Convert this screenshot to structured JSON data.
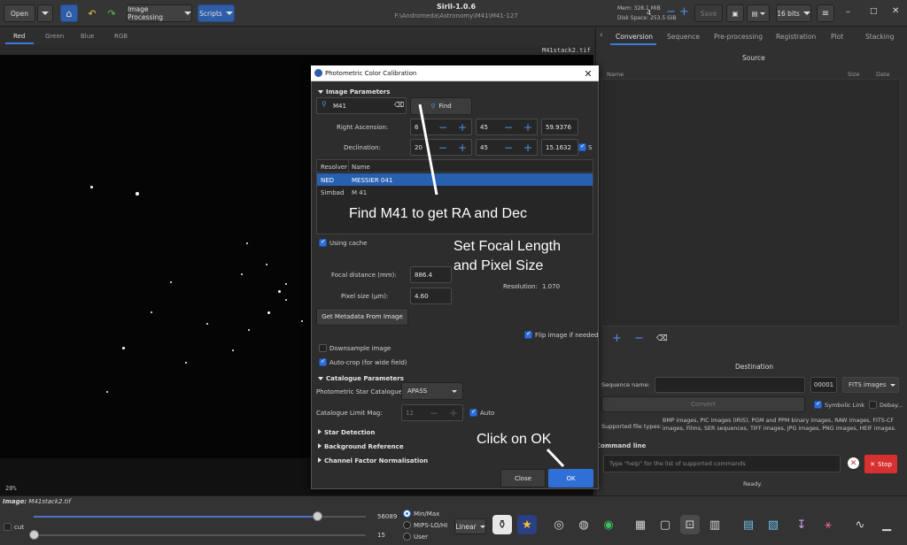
{
  "header": {
    "open_label": "Open",
    "image_processing_label": "Image Processing",
    "scripts_label": "Scripts",
    "app_title": "Siril-1.0.6",
    "app_path": "F:\\Andromeda\\Astronomy\\M41\\M41-127",
    "mem_label": "Mem: 328.1 MiB",
    "disk_label": "Disk Space: 253.5 GiB",
    "threads_value": "4",
    "save_label": "Save",
    "bitdepth_label": "16 bits"
  },
  "channels": {
    "tabs": [
      "Red",
      "Green",
      "Blue",
      "RGB"
    ],
    "image_filename": "M41stack2.tif",
    "zoom": "20%"
  },
  "right_panel": {
    "tabs": [
      "Conversion",
      "Sequence",
      "Pre-processing",
      "Registration",
      "Plot",
      "Stacking"
    ],
    "source_title": "Source",
    "col_name": "Name",
    "col_size": "Size",
    "col_date": "Date",
    "destination_title": "Destination",
    "sequence_name_label": "Sequence name:",
    "seq_number": "00001",
    "fits_format": "FITS images",
    "convert_label": "Convert",
    "symbolic_link_label": "Symbolic Link",
    "debayer_label": "Debay...",
    "supported_label": "Supported file types:",
    "supported_text": "BMP images, PIC images (IRIS), PGM and PPM binary images, RAW images, FITS-CF images, Films, SER sequences, TIFF images, JPG images, PNG images, HEIF images.",
    "command_line_title": "Command line",
    "command_placeholder": "Type \"help\" for the list of supported commands",
    "stop_label": "Stop",
    "status": "Ready."
  },
  "dialog": {
    "title": "Photometric Color Calibration",
    "image_params_title": "Image Parameters",
    "object_value": "M41",
    "find_label": "Find",
    "ra_label": "Right Ascension:",
    "ra_h": "6",
    "ra_m": "45",
    "ra_s": "59.9376",
    "dec_label": "Declination:",
    "dec_d": "20",
    "dec_m": "45",
    "dec_s": "15.1632",
    "south_label": "S",
    "resolver_cols": [
      "Resolver",
      "Name"
    ],
    "resolver_rows": [
      {
        "resolver": "NED",
        "name": "MESSIER 041",
        "selected": true
      },
      {
        "resolver": "Simbad",
        "name": "M  41",
        "selected": false
      }
    ],
    "using_cache_label": "Using cache",
    "focal_label": "Focal distance (mm):",
    "focal_value": "886.4",
    "pixel_label": "Pixel size (µm):",
    "pixel_value": "4.60",
    "resolution_label": "Resolution:",
    "resolution_value": "1.070",
    "metadata_button": "Get Metadata From Image",
    "flip_label": "Flip image if needed",
    "downsample_label": "Downsample image",
    "autocrop_label": "Auto-crop (for wide field)",
    "catalogue_params_title": "Catalogue Parameters",
    "star_catalogue_label": "Photometric Star Catalogue:",
    "star_catalogue_value": "APASS",
    "limit_mag_label": "Catalogue Limit Mag:",
    "limit_mag_value": "12",
    "auto_label": "Auto",
    "star_detection_label": "Star Detection",
    "background_ref_label": "Background Reference",
    "channel_factor_label": "Channel Factor Normalisation",
    "close_label": "Close",
    "ok_label": "OK"
  },
  "annotations": {
    "find_note": "Find M41 to get RA and Dec",
    "focal_note_line1": "Set Focal Length",
    "focal_note_line2": "and Pixel Size",
    "ok_note": "Click on OK"
  },
  "bottom": {
    "image_label": "Image:",
    "image_file": "M41stack2.tif",
    "cut_label": "cut",
    "high_value": "56089",
    "low_value": "15",
    "mode_minmax": "Min/Max",
    "mode_mips": "MIPS-LO/HI",
    "mode_user": "User",
    "stretch_label": "Linear"
  },
  "colors": {
    "accent": "#2f5da8",
    "selection": "#2860b0",
    "stop": "#d83030"
  }
}
